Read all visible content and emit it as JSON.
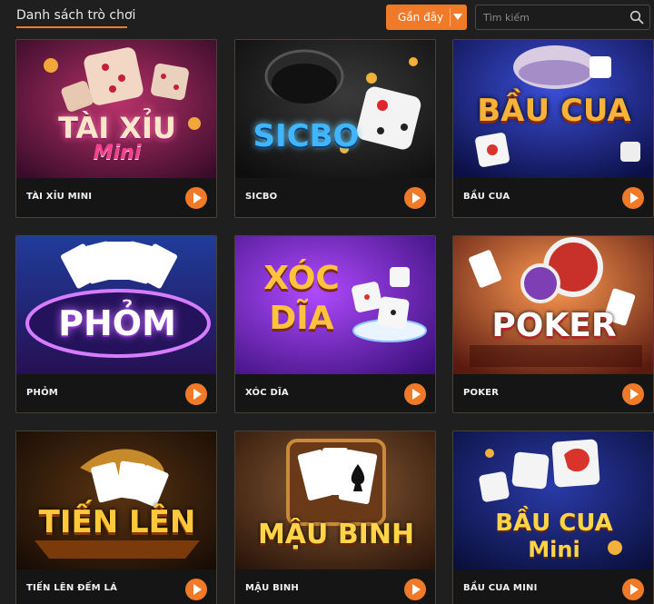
{
  "header": {
    "title": "Danh sách trò chơi",
    "sort_dropdown": {
      "selected": "Gần đây"
    },
    "search": {
      "placeholder": "Tìm kiếm"
    }
  },
  "games": [
    {
      "name": "TÀI XỈU MINI",
      "art_title": "TÀI XỈU",
      "art_subtitle": "Mini"
    },
    {
      "name": "SICBO",
      "art_title": "SICBO"
    },
    {
      "name": "BẦU CUA",
      "art_title": "BẦU CUA"
    },
    {
      "name": "PHỎM",
      "art_title": "PHỎM"
    },
    {
      "name": "XÓC DĨA",
      "art_title": "XÓC",
      "art_subtitle": "DĨA"
    },
    {
      "name": "POKER",
      "art_title": "POKER"
    },
    {
      "name": "TIẾN LÊN ĐẾM LÁ",
      "art_title": "TIẾN LÊN"
    },
    {
      "name": "MẬU BINH",
      "art_title": "MẬU BINH"
    },
    {
      "name": "BẦU CUA MINI",
      "art_title": "BẦU CUA",
      "art_subtitle": "Mini"
    }
  ],
  "colors": {
    "accent": "#f07a28",
    "background": "#1f1f1f",
    "card_border": "#4b4035"
  },
  "icons": {
    "search": "search-icon",
    "play": "play-icon",
    "dropdown": "caret-down-icon"
  }
}
